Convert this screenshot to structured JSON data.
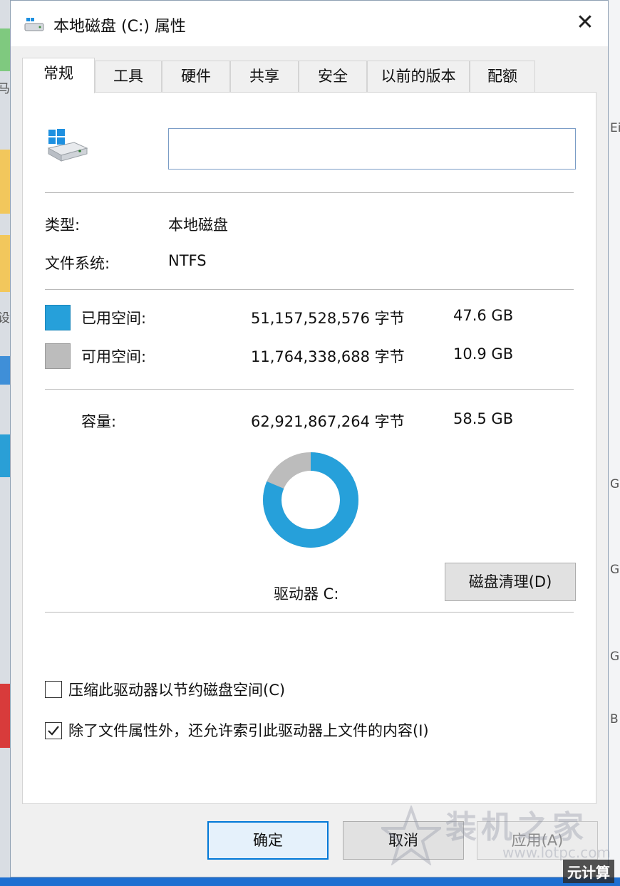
{
  "window": {
    "title": "本地磁盘 (C:) 属性",
    "close_glyph": "✕"
  },
  "tabs": [
    {
      "label": "常规",
      "active": true
    },
    {
      "label": "工具",
      "active": false
    },
    {
      "label": "硬件",
      "active": false
    },
    {
      "label": "共享",
      "active": false
    },
    {
      "label": "安全",
      "active": false
    },
    {
      "label": "以前的版本",
      "active": false
    },
    {
      "label": "配额",
      "active": false
    }
  ],
  "general": {
    "drive_icon": "drive-icon",
    "name_value": "",
    "type_label": "类型:",
    "type_value": "本地磁盘",
    "fs_label": "文件系统:",
    "fs_value": "NTFS",
    "used": {
      "label": "已用空间:",
      "bytes": "51,157,528,576 字节",
      "size": "47.6 GB",
      "color": "#26a0da"
    },
    "free": {
      "label": "可用空间:",
      "bytes": "11,764,338,688 字节",
      "size": "10.9 GB",
      "color": "#bcbcbc"
    },
    "capacity": {
      "label": "容量:",
      "bytes": "62,921,867,264 字节",
      "size": "58.5 GB"
    },
    "usage": {
      "used_fraction": 0.813
    },
    "drive_label": "驱动器 C:",
    "cleanup_button": "磁盘清理(D)",
    "compress_label": "压缩此驱动器以节约磁盘空间(C)",
    "compress_checked": false,
    "index_label": "除了文件属性外，还允许索引此驱动器上文件的内容(I)",
    "index_checked": true
  },
  "buttons": {
    "ok": "确定",
    "cancel": "取消",
    "apply": "应用(A)"
  },
  "watermark": {
    "text": "装机之家",
    "url": "www.lotpc.com"
  },
  "corner_badge": "元计算",
  "background": {
    "left_glyphs": [
      "马",
      "设"
    ],
    "right_glyphs": [
      "Ei",
      "G",
      "G",
      "G",
      "B"
    ]
  }
}
